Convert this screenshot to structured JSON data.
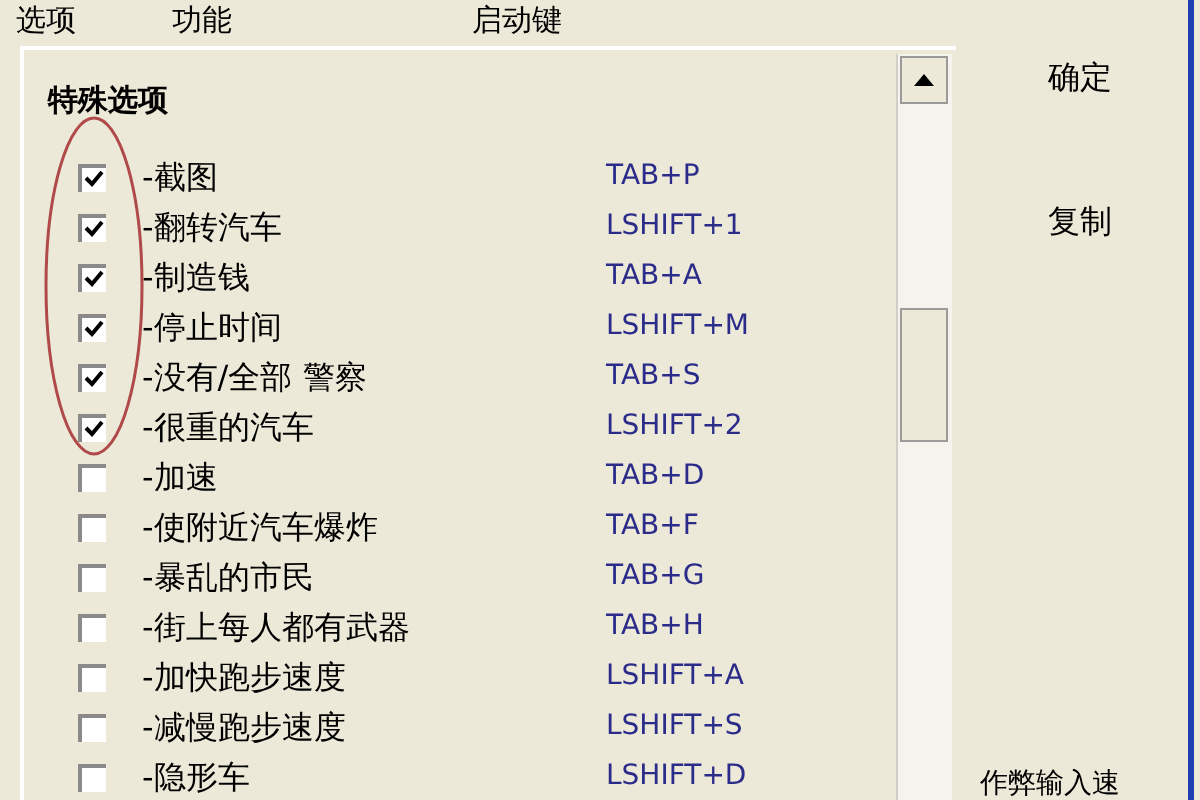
{
  "header": {
    "columns": [
      "选项",
      "功能",
      "启动键"
    ]
  },
  "list": {
    "section_title": "特殊选项",
    "items": [
      {
        "label": "-截图",
        "key": "TAB+P",
        "checked": true
      },
      {
        "label": "-翻转汽车",
        "key": "LSHIFT+1",
        "checked": true
      },
      {
        "label": "-制造钱",
        "key": "TAB+A",
        "checked": true
      },
      {
        "label": "-停止时间",
        "key": "LSHIFT+M",
        "checked": true
      },
      {
        "label": "-没有/全部 警察",
        "key": "TAB+S",
        "checked": true
      },
      {
        "label": "-很重的汽车",
        "key": "LSHIFT+2",
        "checked": true
      },
      {
        "label": "-加速",
        "key": "TAB+D",
        "checked": false
      },
      {
        "label": "-使附近汽车爆炸",
        "key": "TAB+F",
        "checked": false
      },
      {
        "label": "-暴乱的市民",
        "key": "TAB+G",
        "checked": false
      },
      {
        "label": "-街上每人都有武器",
        "key": "TAB+H",
        "checked": false
      },
      {
        "label": "-加快跑步速度",
        "key": "LSHIFT+A",
        "checked": false
      },
      {
        "label": "-减慢跑步速度",
        "key": "LSHIFT+S",
        "checked": false
      },
      {
        "label": "-隐形车",
        "key": "LSHIFT+D",
        "checked": false
      }
    ]
  },
  "buttons": [
    "确定",
    "复制"
  ],
  "bottom_label": "作弊输入速"
}
